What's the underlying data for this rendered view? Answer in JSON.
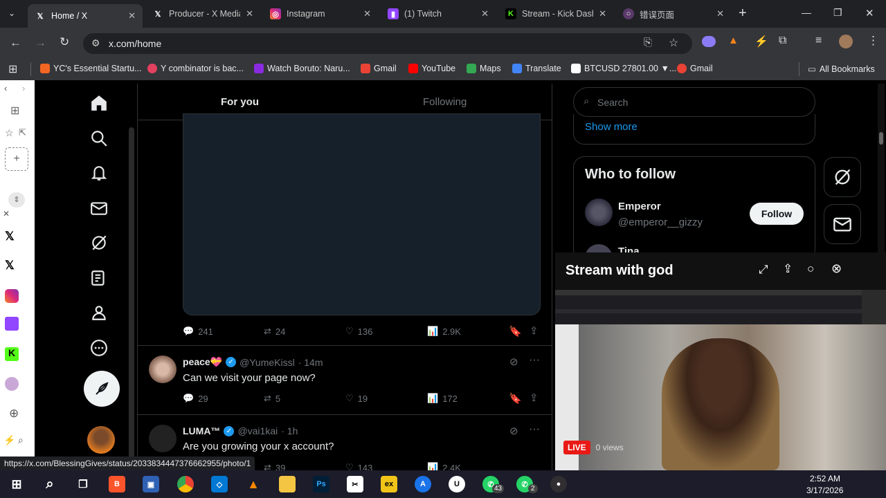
{
  "browser": {
    "tabs": [
      {
        "title": "Home / X",
        "icon": "x-logo-icon",
        "active": true
      },
      {
        "title": "Producer - X Media",
        "icon": "x-logo-icon"
      },
      {
        "title": "Instagram",
        "icon": "instagram-icon"
      },
      {
        "title": "(1) Twitch",
        "icon": "twitch-icon"
      },
      {
        "title": "Stream - Kick Dash",
        "icon": "kick-icon"
      },
      {
        "title": "错误页面",
        "icon": "globe-icon"
      }
    ],
    "url": "x.com/home",
    "bookmarks": [
      {
        "label": "YC's Essential Startu...",
        "color": "#f26522"
      },
      {
        "label": "Y combinator is bac...",
        "color": "#e4405f"
      },
      {
        "label": "Watch Boruto: Naru...",
        "color": "#8a2be2"
      },
      {
        "label": "Gmail",
        "color": "#ea4335"
      },
      {
        "label": "YouTube",
        "color": "#ff0000"
      },
      {
        "label": "Maps",
        "color": "#34a853"
      },
      {
        "label": "Translate",
        "color": "#4285f4"
      },
      {
        "label": "BTCUSD 27801.00 ▼...",
        "color": "#ffffff"
      },
      {
        "label": "Gmail",
        "color": "#ea4335"
      }
    ],
    "all_bookmarks": "All Bookmarks",
    "status_url": "https://x.com/BlessingGives/status/2033834447376662955/photo/1"
  },
  "feed": {
    "tabs": {
      "for_you": "For you",
      "following": "Following"
    },
    "first_actions": {
      "replies": "241",
      "reposts": "24",
      "likes": "136",
      "views": "2.9K"
    },
    "tweets": [
      {
        "name": "peace💝",
        "handle": "@YumeKissl",
        "time": "· 14m",
        "text": "Can we visit your page now?",
        "replies": "29",
        "reposts": "5",
        "likes": "19",
        "views": "172"
      },
      {
        "name": "LUMA™",
        "handle": "@vai1kai",
        "time": "· 1h",
        "text": "Are you growing your x account?",
        "replies": "",
        "reposts": "39",
        "likes": "143",
        "views": "2.4K"
      }
    ]
  },
  "right": {
    "search_placeholder": "Search",
    "show_more": "Show more",
    "who_to_follow": "Who to follow",
    "follow_label": "Follow",
    "users": [
      {
        "name": "Emperor",
        "handle": "@emperor__gizzy"
      },
      {
        "name": "Tina",
        "handle": ""
      }
    ]
  },
  "stream": {
    "title": "Stream with god",
    "live": "LIVE",
    "views": "0 views"
  },
  "taskbar": {
    "time": "2:52 AM",
    "date": "3/17/2026",
    "whatsapp_badge": "43",
    "whatsapp2_badge": "2"
  },
  "colors": {
    "accent": "#1d9bf0",
    "bg": "#000000",
    "border": "#2f3336",
    "muted": "#71767b"
  }
}
